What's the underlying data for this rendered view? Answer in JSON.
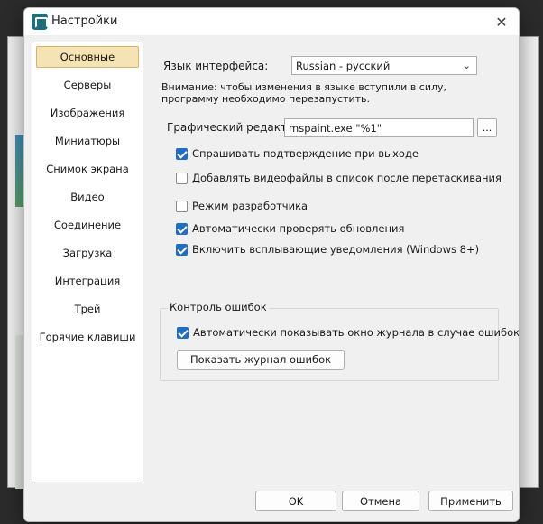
{
  "window": {
    "title": "Настройки",
    "close_glyph": "✕",
    "app_icon": "app-logo-icon"
  },
  "sidebar": {
    "items": [
      {
        "label": "Основные",
        "active": true
      },
      {
        "label": "Серверы"
      },
      {
        "label": "Изображения"
      },
      {
        "label": "Миниатюры"
      },
      {
        "label": "Снимок экрана"
      },
      {
        "label": "Видео"
      },
      {
        "label": "Соединение"
      },
      {
        "label": "Загрузка"
      },
      {
        "label": "Интеграция"
      },
      {
        "label": "Трей"
      },
      {
        "label": "Горячие клавиши"
      }
    ]
  },
  "general": {
    "language_label": "Язык интерфейса:",
    "language_value": "Russian - русский",
    "language_note": "Внимание: чтобы изменения в языке вступили в силу, программу необходимо перезапустить.",
    "editor_label": "Графический редактор:",
    "editor_value": "mspaint.exe \"%1\"",
    "browse_label": "...",
    "checkboxes": [
      {
        "label": "Спрашивать подтверждение при выходе",
        "checked": true
      },
      {
        "label": "Добавлять видеофайлы в список после перетаскивания",
        "checked": false
      },
      {
        "label": "Режим разработчика",
        "checked": false
      },
      {
        "label": "Автоматически проверять обновления",
        "checked": true
      },
      {
        "label": "Включить всплывающие уведомления (Windows 8+)",
        "checked": true
      }
    ],
    "error_group": {
      "title": "Контроль ошибок",
      "auto_show_label": "Автоматически показывать окно журнала в случае ошибок",
      "auto_show_checked": true,
      "show_log_button": "Показать журнал ошибок"
    }
  },
  "footer": {
    "ok": "OK",
    "cancel": "Отмена",
    "apply": "Применить"
  },
  "colors": {
    "accent": "#1e6ec8",
    "active_item_bg": "#f6e3b4"
  }
}
